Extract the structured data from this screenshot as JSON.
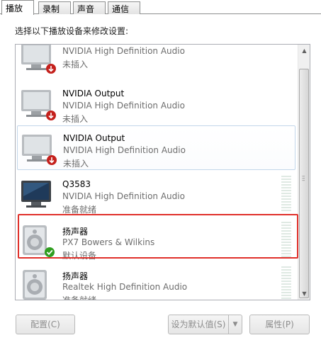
{
  "tabs": [
    {
      "label": "播放",
      "active": true
    },
    {
      "label": "录制",
      "active": false
    },
    {
      "label": "声音",
      "active": false
    },
    {
      "label": "通信",
      "active": false
    }
  ],
  "instruction": "选择以下播放设备来修改设置:",
  "devices": [
    {
      "name": "",
      "desc": "NVIDIA High Definition Audio",
      "status": "未插入",
      "icon": "monitor-unplugged-icon"
    },
    {
      "name": "NVIDIA Output",
      "desc": "NVIDIA High Definition Audio",
      "status": "未插入",
      "icon": "monitor-unplugged-icon"
    },
    {
      "name": "NVIDIA Output",
      "desc": "NVIDIA High Definition Audio",
      "status": "未插入",
      "icon": "monitor-unplugged-icon"
    },
    {
      "name": "Q3583",
      "desc": "NVIDIA High Definition Audio",
      "status": "准备就绪",
      "icon": "monitor-icon"
    },
    {
      "name": "扬声器",
      "desc": "PX7 Bowers & Wilkins",
      "status": "默认设备",
      "icon": "speaker-default-icon"
    },
    {
      "name": "扬声器",
      "desc": "Realtek High Definition Audio",
      "status": "准备就绪",
      "icon": "speaker-icon"
    }
  ],
  "buttons": {
    "configure": "配置(C)",
    "set_default": "设为默认值(S)",
    "properties": "属性(P)"
  },
  "colors": {
    "highlight_border": "#e0302a",
    "unplugged_badge": "#c4201c",
    "default_badge": "#2f9e1f"
  }
}
